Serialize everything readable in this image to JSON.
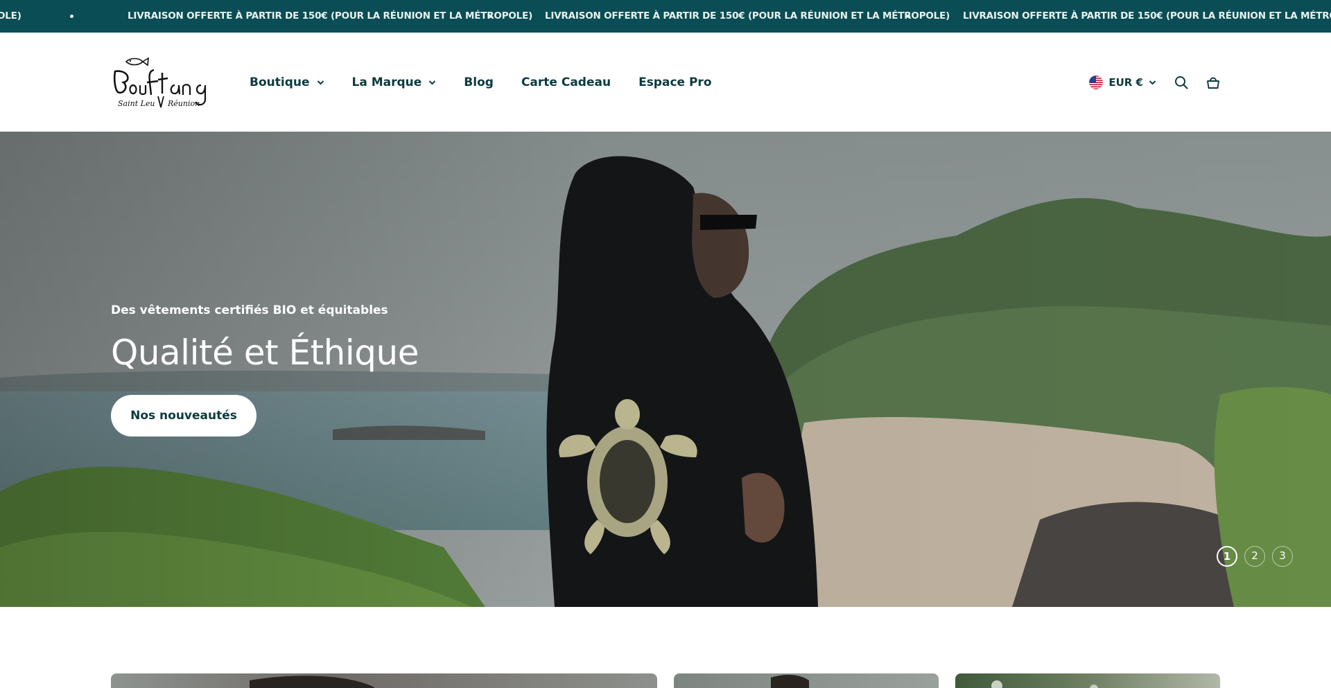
{
  "announcement": {
    "text": "LIVRAISON OFFERTE À PARTIR DE 150€ (POUR LA RÉUNION ET LA MÉTROPOLE)",
    "partial_text": "OLE)"
  },
  "header": {
    "logo": {
      "brand": "Bouftang",
      "tagline": "Saint Leu Réunion"
    },
    "nav": [
      {
        "label": "Boutique",
        "has_dropdown": true
      },
      {
        "label": "La Marque",
        "has_dropdown": true
      },
      {
        "label": "Blog",
        "has_dropdown": false
      },
      {
        "label": "Carte Cadeau",
        "has_dropdown": false
      },
      {
        "label": "Espace Pro",
        "has_dropdown": false
      }
    ],
    "currency": {
      "label": "EUR €",
      "flag_icon": "us-flag-icon"
    },
    "icons": [
      "search-icon",
      "cart-icon"
    ]
  },
  "hero": {
    "subtitle": "Des vêtements certifiés BIO et équitables",
    "title": "Qualité et Éthique",
    "button_label": "Nos nouveautés",
    "pager": [
      "1",
      "2",
      "3"
    ],
    "active_slide": 1
  },
  "colors": {
    "announcement_bg": "#0a4d55",
    "brand_text": "#0b3a3f",
    "button_bg": "#ffffff"
  }
}
